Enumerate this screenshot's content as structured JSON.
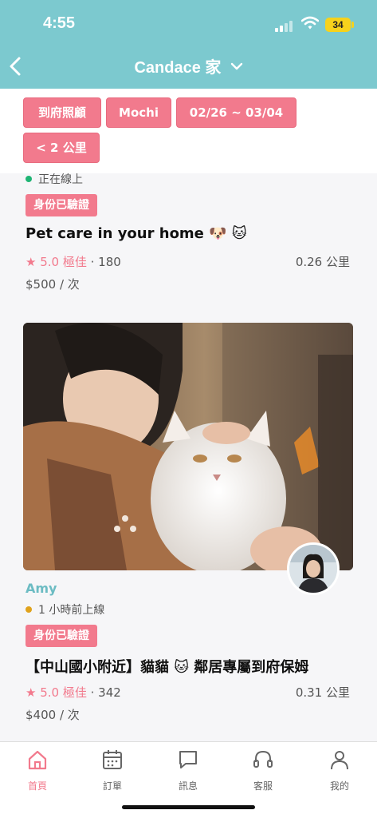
{
  "status_bar": {
    "time": "4:55",
    "battery": "34"
  },
  "header": {
    "title": "Candace 家"
  },
  "filters": [
    {
      "label": "到府照顧"
    },
    {
      "label": "Mochi"
    },
    {
      "label": "02/26 ~ 03/04"
    },
    {
      "label": "< 2 公里"
    }
  ],
  "listings": [
    {
      "online_status": "正在線上",
      "badge": "身份已驗證",
      "title": "Pet care in your home 🐶 🐱",
      "star": "★",
      "rating": "5.0 極佳",
      "reviews": "· 180",
      "distance": "0.26 公里",
      "price": "$500 / 次"
    },
    {
      "name": "Amy",
      "online_status": "1 小時前上線",
      "badge": "身份已驗證",
      "title": "【中山國小附近】貓貓 🐱 鄰居專屬到府保姆",
      "star": "★",
      "rating": "5.0 極佳",
      "reviews": "· 342",
      "distance": "0.31 公里",
      "price": "$400 / 次"
    }
  ],
  "tabs": [
    {
      "label": "首頁",
      "icon": "home-icon",
      "active": true
    },
    {
      "label": "訂單",
      "icon": "calendar-icon",
      "active": false
    },
    {
      "label": "訊息",
      "icon": "chat-icon",
      "active": false
    },
    {
      "label": "客服",
      "icon": "headset-icon",
      "active": false
    },
    {
      "label": "我的",
      "icon": "person-icon",
      "active": false
    }
  ],
  "colors": {
    "header": "#7cc9cf",
    "accent": "#f27a8d",
    "online_dot": "#1fb574",
    "away_dot": "#e0a21c",
    "name": "#6cbcc3"
  }
}
